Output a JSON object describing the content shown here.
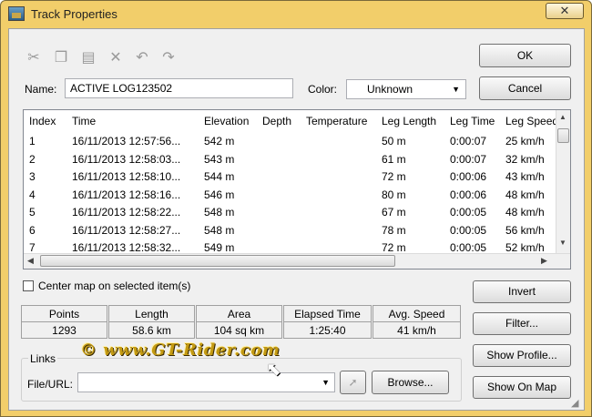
{
  "window": {
    "title": "Track Properties",
    "close_glyph": "✕"
  },
  "toolbar": {
    "icons": [
      "scissors-icon",
      "copy-icon",
      "paste-icon",
      "delete-icon",
      "undo-icon",
      "redo-icon"
    ]
  },
  "form": {
    "name_label": "Name:",
    "name_value": "ACTIVE LOG123502",
    "color_label": "Color:",
    "color_value": "Unknown"
  },
  "buttons": {
    "ok": "OK",
    "cancel": "Cancel",
    "invert": "Invert",
    "filter": "Filter...",
    "show_profile": "Show Profile...",
    "show_on_map": "Show On Map",
    "browse": "Browse..."
  },
  "table": {
    "columns": [
      "Index",
      "Time",
      "Elevation",
      "Depth",
      "Temperature",
      "Leg Length",
      "Leg Time",
      "Leg Speed"
    ],
    "rows": [
      [
        "1",
        "16/11/2013 12:57:56...",
        "542 m",
        "",
        "",
        "50 m",
        "0:00:07",
        "25 km/h"
      ],
      [
        "2",
        "16/11/2013 12:58:03...",
        "543 m",
        "",
        "",
        "61 m",
        "0:00:07",
        "32 km/h"
      ],
      [
        "3",
        "16/11/2013 12:58:10...",
        "544 m",
        "",
        "",
        "72 m",
        "0:00:06",
        "43 km/h"
      ],
      [
        "4",
        "16/11/2013 12:58:16...",
        "546 m",
        "",
        "",
        "80 m",
        "0:00:06",
        "48 km/h"
      ],
      [
        "5",
        "16/11/2013 12:58:22...",
        "548 m",
        "",
        "",
        "67 m",
        "0:00:05",
        "48 km/h"
      ],
      [
        "6",
        "16/11/2013 12:58:27...",
        "548 m",
        "",
        "",
        "78 m",
        "0:00:05",
        "56 km/h"
      ],
      [
        "7",
        "16/11/2013 12:58:32...",
        "549 m",
        "",
        "",
        "72 m",
        "0:00:05",
        "52 km/h"
      ]
    ]
  },
  "center_map_label": "Center map on selected item(s)",
  "stats": [
    {
      "label": "Points",
      "value": "1293"
    },
    {
      "label": "Length",
      "value": "58.6 km"
    },
    {
      "label": "Area",
      "value": "104 sq km"
    },
    {
      "label": "Elapsed Time",
      "value": "1:25:40"
    },
    {
      "label": "Avg. Speed",
      "value": "41 km/h"
    }
  ],
  "links": {
    "group_label": "Links",
    "file_label": "File/URL:",
    "file_value": ""
  },
  "watermark": "©  www.GT-Rider.com"
}
